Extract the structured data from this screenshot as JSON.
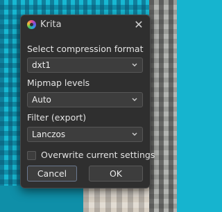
{
  "window": {
    "title": "Krita",
    "close_glyph": "✕"
  },
  "fields": {
    "compression": {
      "label": "Select compression format",
      "value": "dxt1"
    },
    "mipmap": {
      "label": "Mipmap levels",
      "value": "Auto"
    },
    "filter": {
      "label": "Filter (export)",
      "value": "Lanczos"
    }
  },
  "overwrite": {
    "label": "Overwrite current settings",
    "checked": false
  },
  "buttons": {
    "cancel": "Cancel",
    "ok": "OK"
  },
  "icons": {
    "app": "krita-logo-icon",
    "close": "close-icon",
    "dropdown": "chevron-down-icon"
  }
}
